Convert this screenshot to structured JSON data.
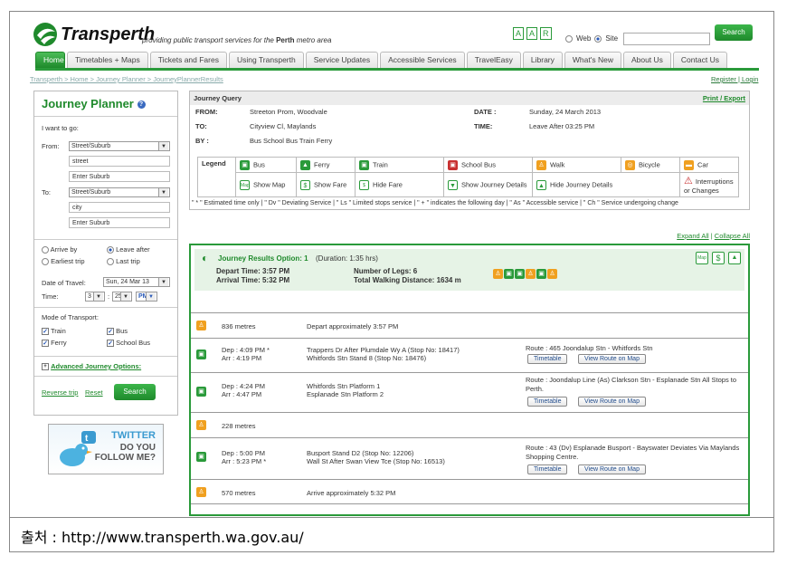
{
  "header": {
    "brand": "Transperth",
    "tagline_pre": "providing public transport services for the ",
    "tagline_bold": "Perth",
    "tagline_post": " metro area",
    "acc_buttons": [
      "A",
      "A",
      "R"
    ],
    "web_label": "Web",
    "site_label": "Site",
    "search_btn": "Search"
  },
  "nav": [
    "Home",
    "Timetables + Maps",
    "Tickets and Fares",
    "Using Transperth",
    "Service Updates",
    "Accessible Services",
    "TravelEasy",
    "Library",
    "What's New",
    "About Us",
    "Contact Us"
  ],
  "breadcrumb": "Transperth > Home > Journey Planner > JourneyPlannerResults",
  "reglog": "Register | Login",
  "planner": {
    "title": "Journey Planner",
    "want": "I want to go:",
    "from_label": "From:",
    "from_type": "Street/Suburb",
    "from_street": "street",
    "from_suburb": "Enter Suburb",
    "to_label": "To:",
    "to_type": "Street/Suburb",
    "to_city": "city",
    "to_suburb": "Enter Suburb",
    "arrive_by": "Arrive by",
    "leave_after": "Leave after",
    "earliest": "Earliest trip",
    "last": "Last trip",
    "date_label": "Date of Travel:",
    "date_value": "Sun, 24 Mar 13",
    "time_label": "Time:",
    "hour": "3",
    "minute": "25",
    "ampm": "PM",
    "mode_label": "Mode of Transport:",
    "train": "Train",
    "bus": "Bus",
    "ferry": "Ferry",
    "school_bus": "School Bus",
    "advanced": "Advanced Journey Options:",
    "reverse": "Reverse trip",
    "reset": "Reset",
    "search": "Search"
  },
  "twitter": {
    "name": "TWITTER",
    "line1": "DO YOU",
    "line2": "FOLLOW ME?"
  },
  "query": {
    "heading": "Journey Query",
    "print": "Print / Export",
    "from_k": "FROM:",
    "from_v": "Streeton Prom, Woodvale",
    "date_k": "DATE :",
    "date_v": "Sunday, 24 March 2013",
    "to_k": "TO:",
    "to_v": "Cityview Cl, Maylands",
    "time_k": "TIME:",
    "time_v": "Leave After 03:25 PM",
    "by_k": "BY :",
    "by_v": "Bus School Bus Train Ferry",
    "legend": "Legend",
    "leg_bus": "Bus",
    "leg_ferry": "Ferry",
    "leg_train": "Train",
    "leg_school": "School Bus",
    "leg_walk": "Walk",
    "leg_bike": "Bicycle",
    "leg_car": "Car",
    "show_map": "Show Map",
    "show_fare": "Show Fare",
    "hide_fare": "Hide Fare",
    "show_details": "Show Journey Details",
    "hide_details": "Hide Journey Details",
    "interrupt": "Interruptions or Changes",
    "note": "\" * \" Estimated time only | \" Dv \" Deviating Service | \" Ls \" Limited stops service | \" + \" indicates the following day | \" As \" Accessible service | \" Ch \" Service undergoing change"
  },
  "links": {
    "expand": "Expand All",
    "collapse": "Collapse All"
  },
  "result": {
    "title": "Journey Results Option: 1",
    "duration": "(Duration:  1:35 hrs)",
    "depart": "Depart Time: 3:57 PM",
    "arrive": "Arrival Time: 5:32 PM",
    "legs": "Number of Legs:  6",
    "walking": "Total Walking Distance: 1634 m",
    "segments": [
      {
        "kind": "walk",
        "dist": "836 metres",
        "desc": "Depart approximately 3:57 PM"
      },
      {
        "kind": "bus",
        "dep": "Dep : 4:09 PM *",
        "arr": "Arr : 4:19 PM",
        "from": "Trappers Dr After Plumdale Wy A (Stop No: 18417)",
        "to": "Whitfords Stn Stand 8 (Stop No: 18476)",
        "route": "Route : 465 Joondalup Stn - Whitfords Stn"
      },
      {
        "kind": "train",
        "dep": "Dep : 4:24 PM",
        "arr": "Arr : 4:47 PM",
        "from": "Whitfords Stn Platform 1",
        "to": "Esplanade Stn Platform 2",
        "route": "Route : Joondalup Line (As) Clarkson Stn - Esplanade Stn All Stops to Perth."
      },
      {
        "kind": "walk",
        "dist": "228 metres"
      },
      {
        "kind": "bus",
        "dep": "Dep : 5:00 PM",
        "arr": "Arr : 5:23 PM *",
        "from": "Busport Stand D2 (Stop No: 12206)",
        "to": "Wall St After Swan View Tce (Stop No: 16513)",
        "route": "Route : 43 (Dv) Esplanade Busport - Bayswater Deviates Via Maylands Shopping Centre."
      },
      {
        "kind": "walk",
        "dist": "570 metres",
        "desc": "Arrive approximately 5:32 PM"
      }
    ],
    "timetable": "Timetable",
    "view_route": "View Route on Map"
  },
  "caption": "출처 : http://www.transperth.wa.gov.au/",
  "colors": {
    "brand_green": "#2a9a3a",
    "walk_orange": "#f0a020"
  }
}
